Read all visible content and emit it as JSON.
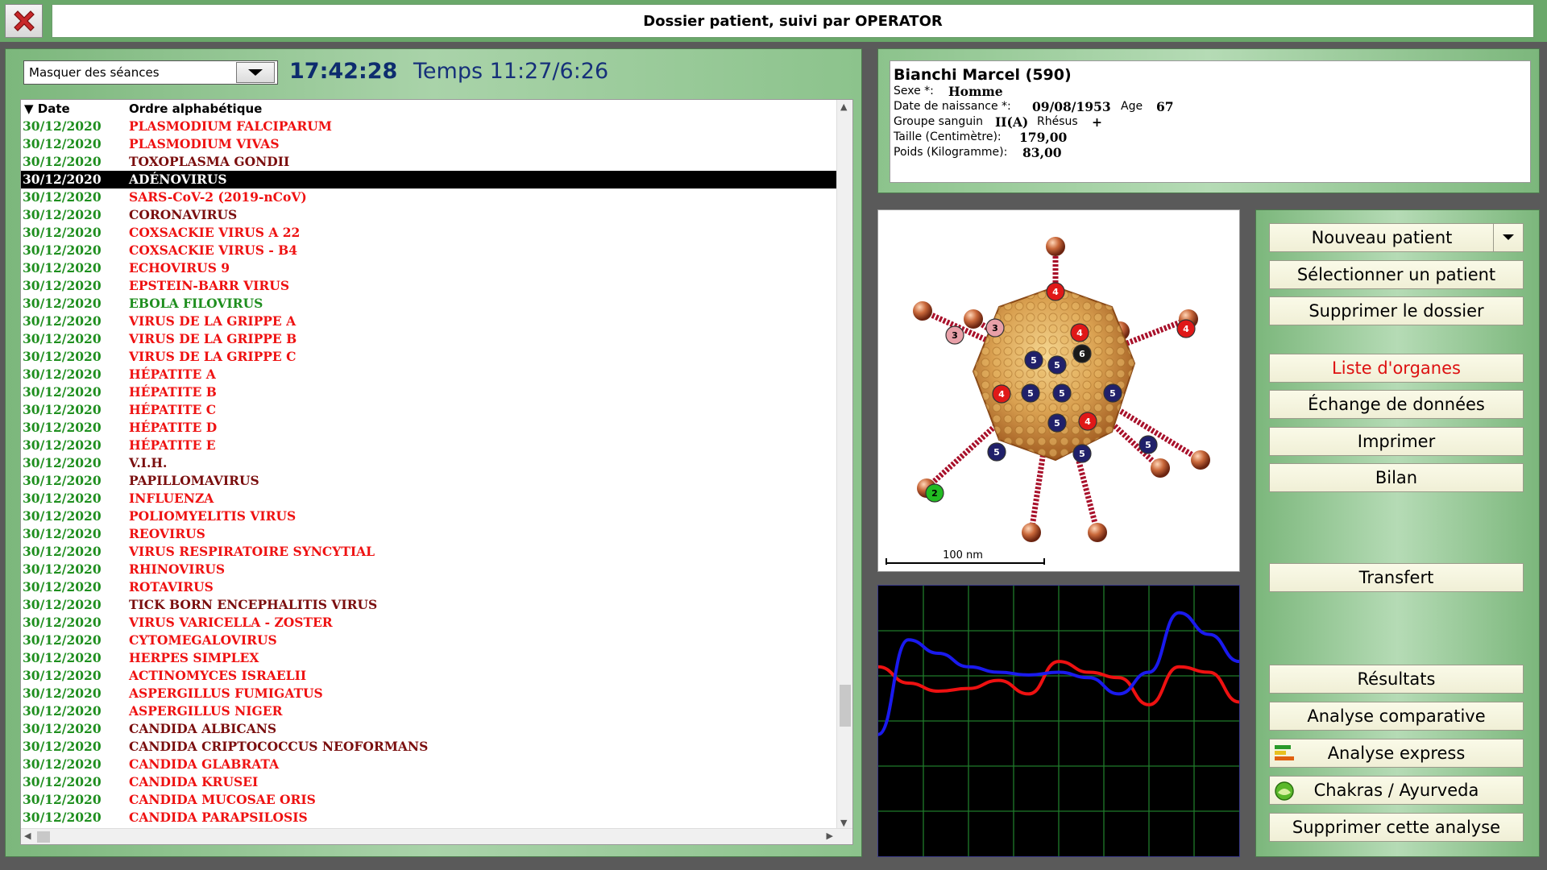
{
  "window": {
    "title": "Dossier patient, suivi par OPERATOR"
  },
  "left": {
    "filter_value": "Masquer des séances",
    "clock": "17:42:28",
    "timer": "Temps 11:27/6:26",
    "header": {
      "date": "▼ Date",
      "name": "Ordre alphabétique"
    },
    "rows": [
      {
        "date": "30/12/2020",
        "name": "PLASMODIUM FALCIPARUM",
        "color": "red"
      },
      {
        "date": "30/12/2020",
        "name": "PLASMODIUM VIVAS",
        "color": "red"
      },
      {
        "date": "30/12/2020",
        "name": "TOXOPLASMA GONDII",
        "color": "dark"
      },
      {
        "date": "30/12/2020",
        "name": "ADÉNOVIRUS",
        "color": "dark",
        "selected": true
      },
      {
        "date": "30/12/2020",
        "name": "SARS-CoV-2 (2019-nCoV)",
        "color": "red"
      },
      {
        "date": "30/12/2020",
        "name": "CORONAVIRUS",
        "color": "dark"
      },
      {
        "date": "30/12/2020",
        "name": "COXSACKIE VIRUS A 22",
        "color": "red"
      },
      {
        "date": "30/12/2020",
        "name": "COXSACKIE VIRUS - B4",
        "color": "red"
      },
      {
        "date": "30/12/2020",
        "name": "ECHOVIRUS 9",
        "color": "red"
      },
      {
        "date": "30/12/2020",
        "name": "EPSTEIN-BARR VIRUS",
        "color": "red"
      },
      {
        "date": "30/12/2020",
        "name": "EBOLA FILOVIRUS",
        "color": "green"
      },
      {
        "date": "30/12/2020",
        "name": "VIRUS DE LA GRIPPE A",
        "color": "red"
      },
      {
        "date": "30/12/2020",
        "name": "VIRUS DE LA GRIPPE B",
        "color": "red"
      },
      {
        "date": "30/12/2020",
        "name": "VIRUS DE LA GRIPPE C",
        "color": "red"
      },
      {
        "date": "30/12/2020",
        "name": "HÉPATITE A",
        "color": "red"
      },
      {
        "date": "30/12/2020",
        "name": "HÉPATITE B",
        "color": "red"
      },
      {
        "date": "30/12/2020",
        "name": "HÉPATITE C",
        "color": "red"
      },
      {
        "date": "30/12/2020",
        "name": "HÉPATITE D",
        "color": "red"
      },
      {
        "date": "30/12/2020",
        "name": "HÉPATITE E",
        "color": "red"
      },
      {
        "date": "30/12/2020",
        "name": "V.I.H.",
        "color": "dark"
      },
      {
        "date": "30/12/2020",
        "name": "PAPILLOMAVIRUS",
        "color": "dark"
      },
      {
        "date": "30/12/2020",
        "name": "INFLUENZA",
        "color": "red"
      },
      {
        "date": "30/12/2020",
        "name": "POLIOMYELITIS VIRUS",
        "color": "red"
      },
      {
        "date": "30/12/2020",
        "name": "REOVIRUS",
        "color": "red"
      },
      {
        "date": "30/12/2020",
        "name": "VIRUS RESPIRATOIRE SYNCYTIAL",
        "color": "red"
      },
      {
        "date": "30/12/2020",
        "name": "RHINOVIRUS",
        "color": "red"
      },
      {
        "date": "30/12/2020",
        "name": "ROTAVIRUS",
        "color": "red"
      },
      {
        "date": "30/12/2020",
        "name": "TICK BORN ENCEPHALITIS VIRUS",
        "color": "dark"
      },
      {
        "date": "30/12/2020",
        "name": "VIRUS VARICELLA - ZOSTER",
        "color": "red"
      },
      {
        "date": "30/12/2020",
        "name": "CYTOMEGALOVIRUS",
        "color": "red"
      },
      {
        "date": "30/12/2020",
        "name": "HERPES SIMPLEX",
        "color": "red"
      },
      {
        "date": "30/12/2020",
        "name": "ACTINOMYCES ISRAELII",
        "color": "red"
      },
      {
        "date": "30/12/2020",
        "name": "ASPERGILLUS FUMIGATUS",
        "color": "red"
      },
      {
        "date": "30/12/2020",
        "name": "ASPERGILLUS NIGER",
        "color": "red"
      },
      {
        "date": "30/12/2020",
        "name": "CANDIDA ALBICANS",
        "color": "dark"
      },
      {
        "date": "30/12/2020",
        "name": "CANDIDA CRIPTOCOCCUS NEOFORMANS",
        "color": "dark"
      },
      {
        "date": "30/12/2020",
        "name": "CANDIDA GLABRATA",
        "color": "red"
      },
      {
        "date": "30/12/2020",
        "name": "CANDIDA KRUSEI",
        "color": "red"
      },
      {
        "date": "30/12/2020",
        "name": "CANDIDA MUCOSAE ORIS",
        "color": "red"
      },
      {
        "date": "30/12/2020",
        "name": "CANDIDA PARAPSILOSIS",
        "color": "red"
      }
    ]
  },
  "patient": {
    "name": "Bianchi Marcel (590)",
    "sex_label": "Sexe *:",
    "sex": "Homme",
    "dob_label": "Date de naissance *:",
    "dob": "09/08/1953",
    "age_label": "Age",
    "age": "67",
    "blood_label": "Groupe sanguin",
    "blood": "II(A)",
    "rhesus_label": "Rhésus",
    "rhesus": "+",
    "height_label": "Taille (Centimètre):",
    "height": "179,00",
    "weight_label": "Poids (Kilogramme):",
    "weight": "83,00"
  },
  "virus_image": {
    "scale_label": "100 nm",
    "markers": [
      {
        "label": "4",
        "color": "red"
      },
      {
        "label": "3",
        "color": "pink"
      },
      {
        "label": "3",
        "color": "pink"
      },
      {
        "label": "4",
        "color": "red"
      },
      {
        "label": "4",
        "color": "red"
      },
      {
        "label": "5",
        "color": "navy"
      },
      {
        "label": "5",
        "color": "navy"
      },
      {
        "label": "6",
        "color": "black"
      },
      {
        "label": "4",
        "color": "red"
      },
      {
        "label": "5",
        "color": "navy"
      },
      {
        "label": "5",
        "color": "navy"
      },
      {
        "label": "5",
        "color": "navy"
      },
      {
        "label": "4",
        "color": "red"
      },
      {
        "label": "5",
        "color": "navy"
      },
      {
        "label": "5",
        "color": "navy"
      },
      {
        "label": "5",
        "color": "navy"
      },
      {
        "label": "5",
        "color": "navy"
      },
      {
        "label": "2",
        "color": "green"
      }
    ]
  },
  "graph": {
    "grid_color": "#1f7a2a",
    "blue_series": [
      0.55,
      0.2,
      0.25,
      0.3,
      0.32,
      0.33,
      0.32,
      0.34,
      0.4,
      0.32,
      0.1,
      0.18,
      0.28
    ],
    "red_series": [
      0.3,
      0.36,
      0.39,
      0.38,
      0.35,
      0.4,
      0.28,
      0.32,
      0.34,
      0.44,
      0.3,
      0.32,
      0.43
    ]
  },
  "buttons": {
    "new_patient": "Nouveau patient",
    "select_patient": "Sélectionner un patient",
    "delete_record": "Supprimer le dossier",
    "organ_list": "Liste d'organes",
    "data_exchange": "Échange de données",
    "print": "Imprimer",
    "report": "Bilan",
    "transfer": "Transfert",
    "results": "Résultats",
    "comparative": "Analyse comparative",
    "express": "Analyse express",
    "chakras": "Chakras / Ayurveda",
    "delete_analysis": "Supprimer cette analyse"
  },
  "colors": {
    "red": "#ee1111",
    "dark": "#7a0e0e",
    "green": "#1e8e1e",
    "panel_green": "#7cb77c"
  }
}
